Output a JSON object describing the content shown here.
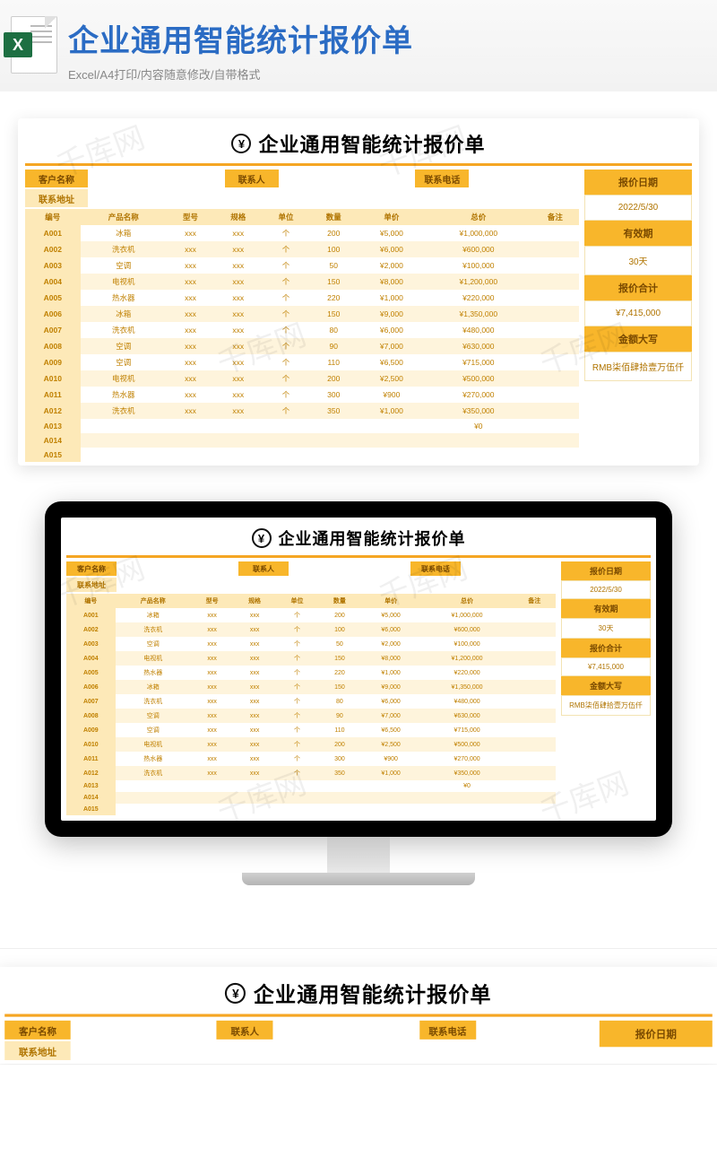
{
  "hero": {
    "title": "企业通用智能统计报价单",
    "subtitle": "Excel/A4打印/内容随意修改/自带格式",
    "icon_letter": "X"
  },
  "sheet": {
    "title": "企业通用智能统计报价单",
    "currency_symbol": "¥",
    "info": {
      "customer_label": "客户名称",
      "contact_label": "联系人",
      "phone_label": "联系电话",
      "address_label": "联系地址"
    },
    "columns": [
      "编号",
      "产品名称",
      "型号",
      "规格",
      "单位",
      "数量",
      "单价",
      "总价",
      "备注"
    ],
    "rows": [
      {
        "id": "A001",
        "name": "冰箱",
        "model": "xxx",
        "spec": "xxx",
        "unit": "个",
        "qty": "200",
        "price": "¥5,000",
        "total": "¥1,000,000",
        "note": ""
      },
      {
        "id": "A002",
        "name": "洗衣机",
        "model": "xxx",
        "spec": "xxx",
        "unit": "个",
        "qty": "100",
        "price": "¥6,000",
        "total": "¥600,000",
        "note": ""
      },
      {
        "id": "A003",
        "name": "空调",
        "model": "xxx",
        "spec": "xxx",
        "unit": "个",
        "qty": "50",
        "price": "¥2,000",
        "total": "¥100,000",
        "note": ""
      },
      {
        "id": "A004",
        "name": "电视机",
        "model": "xxx",
        "spec": "xxx",
        "unit": "个",
        "qty": "150",
        "price": "¥8,000",
        "total": "¥1,200,000",
        "note": ""
      },
      {
        "id": "A005",
        "name": "热水器",
        "model": "xxx",
        "spec": "xxx",
        "unit": "个",
        "qty": "220",
        "price": "¥1,000",
        "total": "¥220,000",
        "note": ""
      },
      {
        "id": "A006",
        "name": "冰箱",
        "model": "xxx",
        "spec": "xxx",
        "unit": "个",
        "qty": "150",
        "price": "¥9,000",
        "total": "¥1,350,000",
        "note": ""
      },
      {
        "id": "A007",
        "name": "洗衣机",
        "model": "xxx",
        "spec": "xxx",
        "unit": "个",
        "qty": "80",
        "price": "¥6,000",
        "total": "¥480,000",
        "note": ""
      },
      {
        "id": "A008",
        "name": "空调",
        "model": "xxx",
        "spec": "xxx",
        "unit": "个",
        "qty": "90",
        "price": "¥7,000",
        "total": "¥630,000",
        "note": ""
      },
      {
        "id": "A009",
        "name": "空调",
        "model": "xxx",
        "spec": "xxx",
        "unit": "个",
        "qty": "110",
        "price": "¥6,500",
        "total": "¥715,000",
        "note": ""
      },
      {
        "id": "A010",
        "name": "电视机",
        "model": "xxx",
        "spec": "xxx",
        "unit": "个",
        "qty": "200",
        "price": "¥2,500",
        "total": "¥500,000",
        "note": ""
      },
      {
        "id": "A011",
        "name": "热水器",
        "model": "xxx",
        "spec": "xxx",
        "unit": "个",
        "qty": "300",
        "price": "¥900",
        "total": "¥270,000",
        "note": ""
      },
      {
        "id": "A012",
        "name": "洗衣机",
        "model": "xxx",
        "spec": "xxx",
        "unit": "个",
        "qty": "350",
        "price": "¥1,000",
        "total": "¥350,000",
        "note": ""
      },
      {
        "id": "A013",
        "name": "",
        "model": "",
        "spec": "",
        "unit": "",
        "qty": "",
        "price": "",
        "total": "¥0",
        "note": ""
      },
      {
        "id": "A014",
        "name": "",
        "model": "",
        "spec": "",
        "unit": "",
        "qty": "",
        "price": "",
        "total": "",
        "note": ""
      },
      {
        "id": "A015",
        "name": "",
        "model": "",
        "spec": "",
        "unit": "",
        "qty": "",
        "price": "",
        "total": "",
        "note": ""
      }
    ],
    "side": {
      "date_label": "报价日期",
      "date_value": "2022/5/30",
      "validity_label": "有效期",
      "validity_value": "30天",
      "total_label": "报价合计",
      "total_value": "¥7,415,000",
      "caps_label": "金额大写",
      "caps_value": "RMB柒佰肆拾壹万伍仟"
    }
  },
  "watermark": "千库网"
}
